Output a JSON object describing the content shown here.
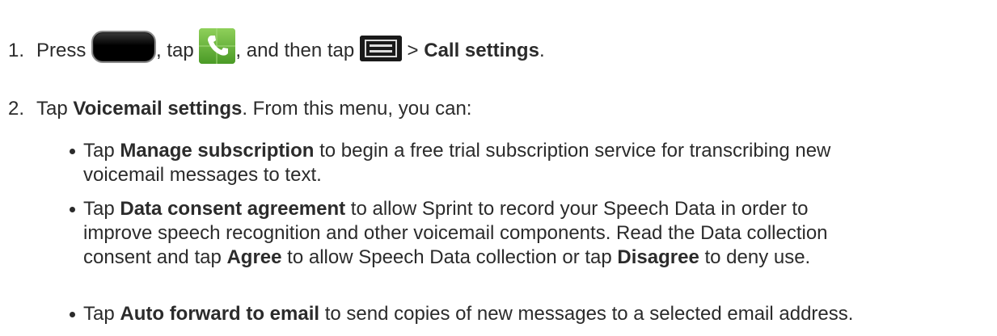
{
  "steps": [
    {
      "number": "1.",
      "parts": {
        "press": "Press",
        "comma_tap": ", tap",
        "and_then_tap": ", and then tap",
        "gt": ">",
        "call_settings": "Call settings",
        "period": "."
      },
      "icons": [
        "home-button-icon",
        "phone-app-icon",
        "menu-icon"
      ]
    },
    {
      "number": "2.",
      "parts": {
        "tap": "Tap",
        "voicemail_settings": "Voicemail settings",
        "rest": ". From this menu, you can:"
      }
    }
  ],
  "bullets": [
    {
      "lines": [
        {
          "pre": "Tap ",
          "bold": "Manage subscription",
          "post": " to begin a free trial subscription service for transcribing new"
        },
        {
          "pre": "voicemail messages to text."
        }
      ]
    },
    {
      "lines": [
        {
          "pre": "Tap ",
          "bold": "Data consent agreement",
          "post": " to allow Sprint to record your Speech Data in order to"
        },
        {
          "pre": "improve speech recognition and other voicemail components. Read the Data collection"
        },
        {
          "pre": "consent and tap ",
          "bold": "Agree",
          "post": " to allow Speech Data collection or tap ",
          "bold2": "Disagree",
          "post2": " to deny use."
        }
      ]
    },
    {
      "lines": [
        {
          "pre": "Tap ",
          "bold": "Auto forward to email",
          "post": " to send copies of new messages to a selected email address."
        }
      ]
    }
  ]
}
